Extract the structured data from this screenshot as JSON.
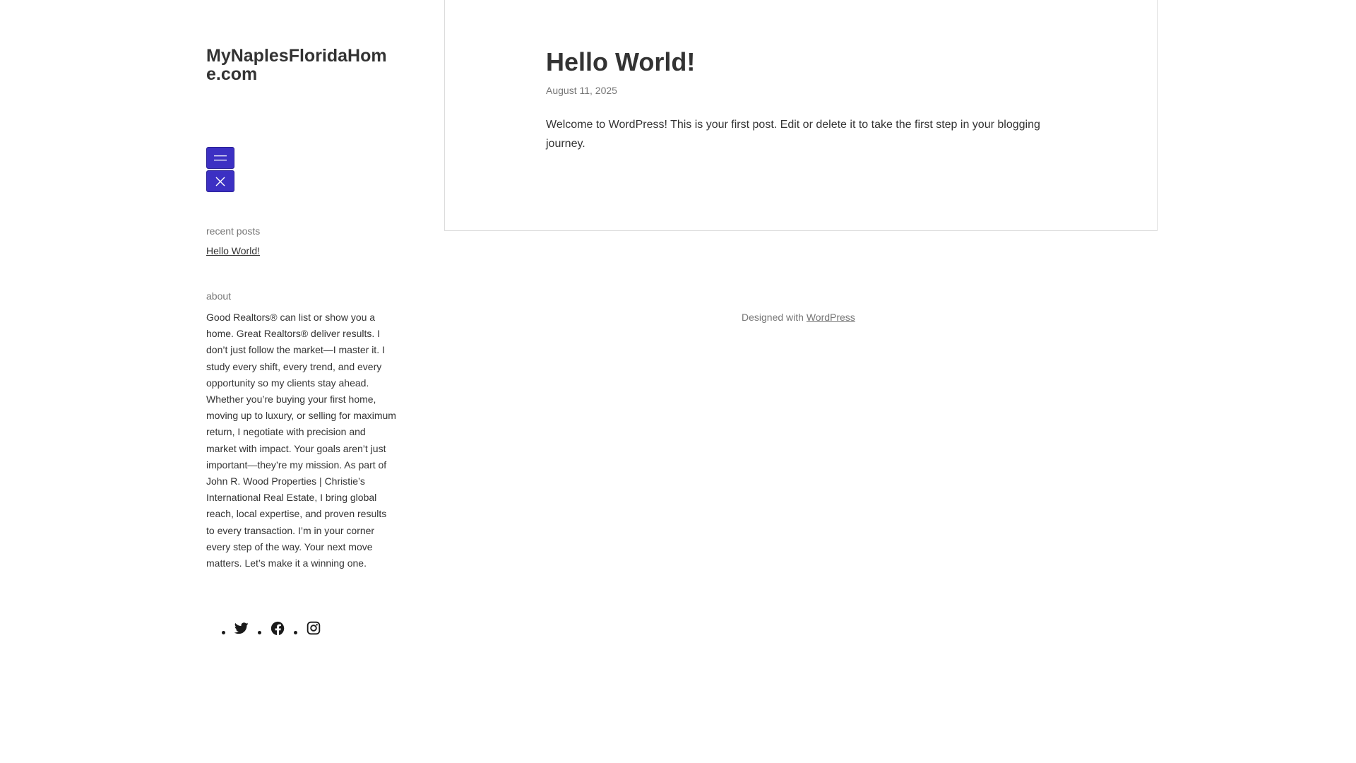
{
  "site": {
    "title": "MyNaplesFloridaHome.com"
  },
  "sidebar": {
    "menu_open_icon": "hamburger-menu-icon",
    "menu_close_icon": "close-icon",
    "recent_posts_heading": "recent posts",
    "recent_posts": [
      {
        "label": "Hello World!"
      }
    ],
    "about_heading": "about",
    "about_text": "Good Realtors® can list or show you a home. Great Realtors® deliver results. I don’t just follow the market—I master it. I study every shift, every trend, and every opportunity so my clients stay ahead. Whether you’re buying your first home, moving up to luxury, or selling for maximum return, I negotiate with precision and market with impact. Your goals aren’t just important—they’re my mission. As part of John R. Wood Properties | Christie’s International Real Estate, I bring global reach, local expertise, and proven results to every transaction. I’m in your corner every step of the way. Your next move matters. Let’s make it a winning one.",
    "social": [
      "twitter-icon",
      "facebook-icon",
      "instagram-icon"
    ]
  },
  "post": {
    "title": "Hello World!",
    "date": "August 11, 2025",
    "body": "Welcome to WordPress! This is your first post. Edit or delete it to take the first step in your blogging journey."
  },
  "footer": {
    "prefix": "Designed with ",
    "link_label": "WordPress"
  },
  "colors": {
    "accent": "#3c30c3",
    "text": "#333333",
    "muted": "#767676",
    "border": "#dcdcdc"
  }
}
